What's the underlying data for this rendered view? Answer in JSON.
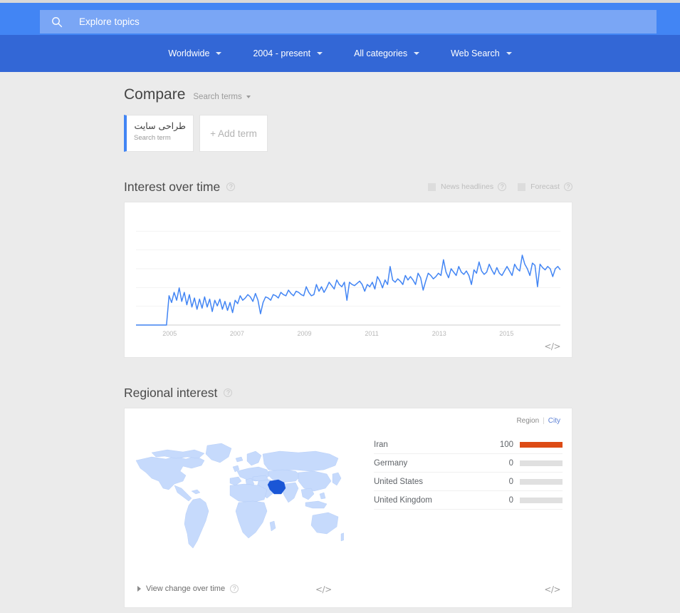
{
  "header": {
    "search": {
      "icon": "search-icon",
      "placeholder": "Explore topics",
      "value": ""
    },
    "nav": [
      {
        "label": "Worldwide"
      },
      {
        "label": "2004 - present"
      },
      {
        "label": "All categories"
      },
      {
        "label": "Web Search"
      }
    ]
  },
  "compare": {
    "title": "Compare",
    "kind_label": "Search terms",
    "terms": [
      {
        "text": "طراحی سایت",
        "sub": "Search term",
        "accent": "#4285f4"
      }
    ],
    "add_label": "+ Add term"
  },
  "interest_over_time": {
    "title": "Interest over time",
    "help": "?",
    "options": [
      {
        "label": "News headlines",
        "checked": false,
        "help": "?"
      },
      {
        "label": "Forecast",
        "checked": false,
        "help": "?"
      }
    ],
    "embed_icon": "</>"
  },
  "regional_interest": {
    "title": "Regional interest",
    "help": "?",
    "toggle": {
      "region_label": "Region",
      "separator": "|",
      "city_label": "City",
      "selected": "Region"
    },
    "map": {
      "highlight_country": "Iran",
      "highlight_color": "#1a56d6",
      "base_color": "#c6dafc"
    },
    "rankings": [
      {
        "name": "Iran",
        "value": 100
      },
      {
        "name": "Germany",
        "value": 0
      },
      {
        "name": "United States",
        "value": 0
      },
      {
        "name": "United Kingdom",
        "value": 0
      }
    ],
    "bar_color": "#dd4b15",
    "view_change_label": "View change over time",
    "view_change_help": "?",
    "embed_icon_middle": "</>",
    "embed_icon_right": "</>"
  },
  "chart_data": {
    "type": "line",
    "title": "Interest over time",
    "xlabel": "",
    "ylabel": "",
    "xticks": [
      "2005",
      "2007",
      "2009",
      "2011",
      "2013",
      "2015"
    ],
    "xlim": [
      "2004-01",
      "2016-08"
    ],
    "ylim": [
      0,
      100
    ],
    "grid": true,
    "legend": false,
    "series": [
      {
        "name": "طراحی سایت",
        "color": "#4285f4",
        "values": [
          0,
          0,
          0,
          0,
          0,
          0,
          0,
          0,
          0,
          0,
          0,
          0,
          0,
          26,
          20,
          29,
          22,
          33,
          21,
          29,
          18,
          27,
          16,
          24,
          14,
          23,
          15,
          25,
          16,
          23,
          12,
          22,
          17,
          23,
          14,
          21,
          13,
          20,
          11,
          22,
          19,
          26,
          22,
          24,
          27,
          25,
          21,
          28,
          22,
          10,
          20,
          25,
          24,
          22,
          27,
          26,
          24,
          29,
          27,
          26,
          31,
          28,
          26,
          30,
          29,
          27,
          26,
          34,
          29,
          26,
          27,
          36,
          30,
          34,
          29,
          33,
          38,
          35,
          32,
          40,
          36,
          34,
          38,
          22,
          38,
          36,
          35,
          37,
          39,
          36,
          30,
          36,
          34,
          38,
          32,
          43,
          39,
          33,
          40,
          36,
          52,
          40,
          38,
          41,
          39,
          36,
          44,
          40,
          43,
          40,
          36,
          46,
          42,
          31,
          39,
          46,
          44,
          41,
          43,
          46,
          44,
          58,
          47,
          42,
          50,
          47,
          44,
          52,
          47,
          45,
          48,
          44,
          36,
          49,
          46,
          56,
          48,
          45,
          47,
          54,
          49,
          45,
          51,
          46,
          44,
          48,
          52,
          48,
          44,
          54,
          50,
          48,
          62,
          54,
          50,
          44,
          55,
          53,
          34,
          54,
          51,
          49,
          52,
          50,
          43,
          50,
          52,
          49
        ]
      }
    ]
  }
}
